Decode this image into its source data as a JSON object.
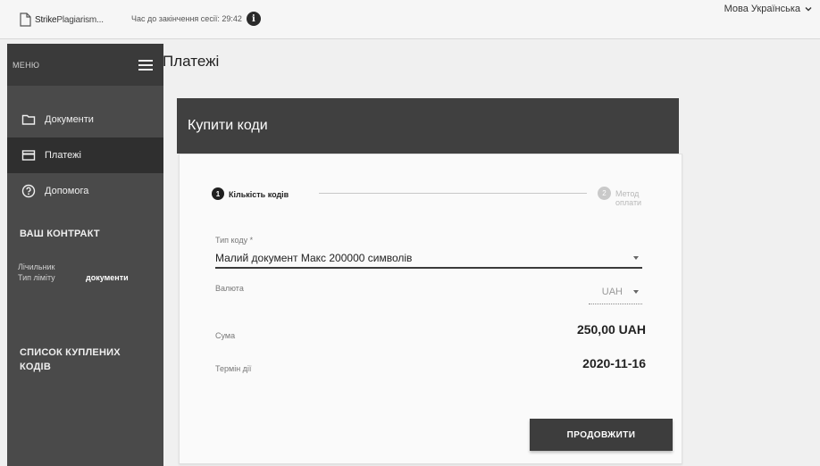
{
  "header": {
    "logo_prefix": "Strike",
    "logo_rest": "Plagiarism...",
    "session": "Час до закінчення сесії: 29:42",
    "info_glyph": "i",
    "language": "Мова Українська"
  },
  "sidebar": {
    "menu_label": "МЕНЮ",
    "items": [
      {
        "label": "Документи",
        "icon": "folder-icon",
        "active": false
      },
      {
        "label": "Платежі",
        "icon": "card-icon",
        "active": true
      },
      {
        "label": "Допомога",
        "icon": "help-icon",
        "active": false
      }
    ],
    "contract_title": "ВАШ КОНТРАКТ",
    "contract_row1": "Лічильник",
    "contract_row2": "Тип ліміту",
    "contract_value": "документи",
    "purchased_title": "СПИСОК КУПЛЕНИХ КОДІВ"
  },
  "main": {
    "page_title": "Платежі",
    "card_title": "Купити коди",
    "steps": [
      {
        "number": "1",
        "label": "Кількість кодів",
        "active": true
      },
      {
        "number": "2",
        "label": "Метод оплати",
        "active": false
      }
    ],
    "code_type_label": "Тип коду *",
    "code_type_value": "Малий документ  Макс 200000 символів",
    "currency_label": "Валюта",
    "currency_value": "UAH",
    "sum_label": "Сума",
    "sum_value": "250,00 UAH",
    "term_label": "Термін дії",
    "term_value": "2020-11-16",
    "continue_label": "ПРОДОВЖИТИ"
  },
  "colors": {
    "sidebar_bg": "#4a4a4a",
    "sidebar_active": "#2f2f2f",
    "card_header": "#404040",
    "button": "#3d3d3d"
  }
}
